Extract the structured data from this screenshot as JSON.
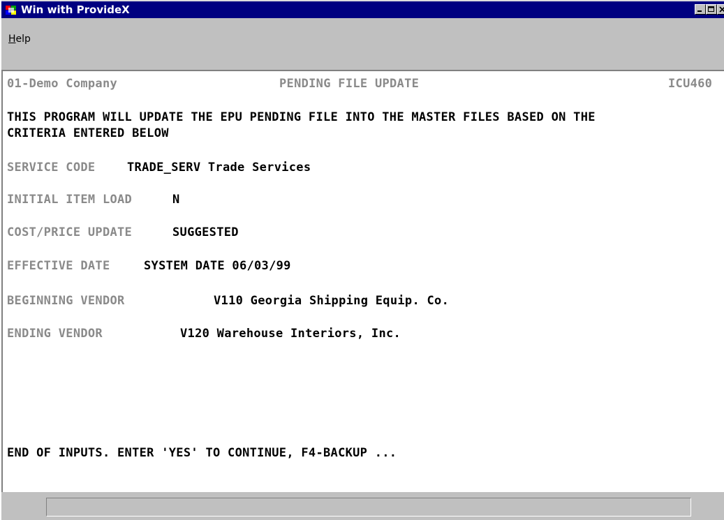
{
  "window": {
    "title": "Win with ProvideX"
  },
  "menu": {
    "items": [
      {
        "label_accel": "H",
        "label_rest": "elp"
      }
    ]
  },
  "screen": {
    "header": {
      "company": "01-Demo Company",
      "title": "PENDING FILE UPDATE",
      "program_code": "ICU460"
    },
    "description_line1": "THIS PROGRAM WILL UPDATE THE EPU PENDING FILE INTO THE MASTER FILES BASED ON THE",
    "description_line2": "CRITERIA ENTERED BELOW",
    "fields": {
      "service_code": {
        "label": "SERVICE CODE",
        "value": "TRADE_SERV Trade Services"
      },
      "initial_item_load": {
        "label": "INITIAL ITEM LOAD",
        "value": "N"
      },
      "cost_price_update": {
        "label": "COST/PRICE UPDATE",
        "value": "SUGGESTED"
      },
      "effective_date": {
        "label": "EFFECTIVE DATE",
        "value": "SYSTEM DATE 06/03/99"
      },
      "beginning_vendor": {
        "label": "BEGINNING VENDOR",
        "value": "V110 Georgia Shipping Equip. Co."
      },
      "ending_vendor": {
        "label": "ENDING VENDOR",
        "value": "V120 Warehouse Interiors, Inc."
      }
    },
    "prompt": "END OF INPUTS. ENTER 'YES' TO CONTINUE, F4-BACKUP ..."
  },
  "statusbar": {
    "text": ""
  },
  "icons": {
    "app": "providex-app-icon",
    "minimize": "minimize-icon",
    "maximize": "maximize-icon",
    "close": "close-icon"
  },
  "colors": {
    "titlebar": "#000080",
    "label_gray": "#8a8a8a",
    "chrome": "#c0c0c0"
  }
}
